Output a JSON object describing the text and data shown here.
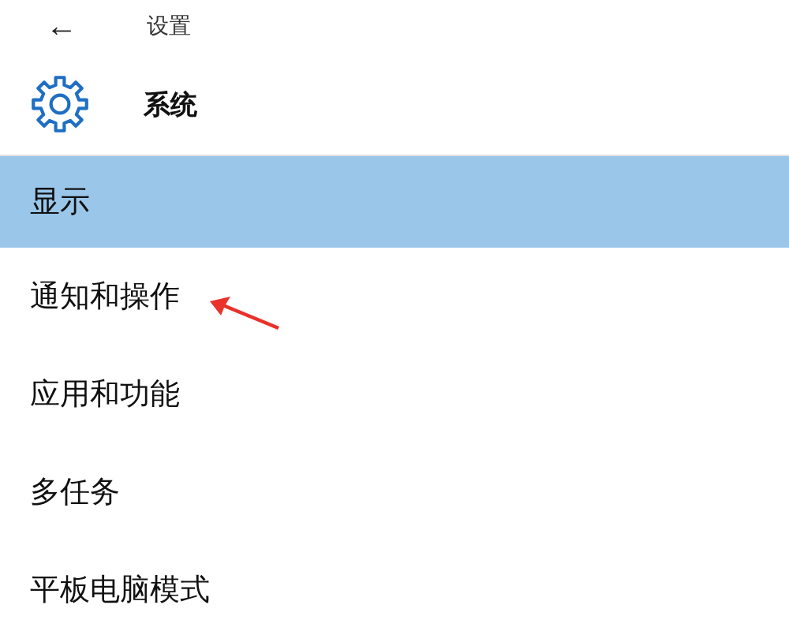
{
  "window": {
    "back": "←",
    "title": "设置"
  },
  "header": {
    "title": "系统"
  },
  "menu": [
    {
      "label": "显示",
      "selected": true
    },
    {
      "label": "通知和操作",
      "selected": false
    },
    {
      "label": "应用和功能",
      "selected": false
    },
    {
      "label": "多任务",
      "selected": false
    },
    {
      "label": "平板电脑模式",
      "selected": false
    }
  ]
}
